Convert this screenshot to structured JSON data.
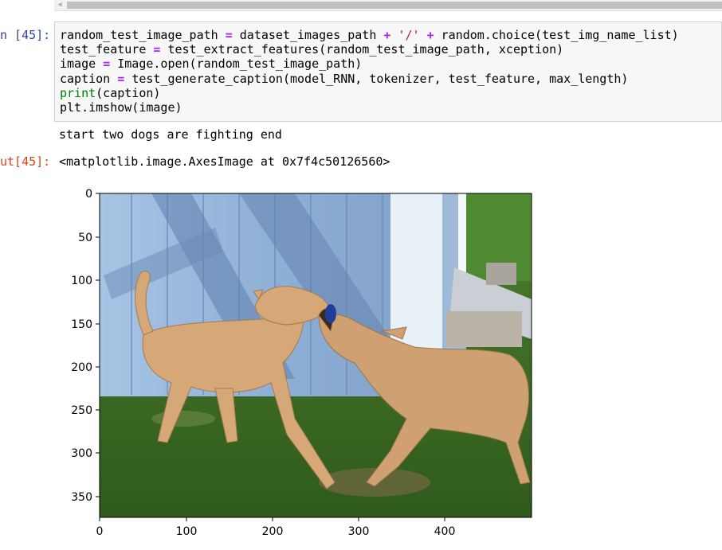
{
  "cell": {
    "in_prompt": "n [45]:",
    "out_prompt": "ut[45]:",
    "code": {
      "line1": {
        "v1": "random_test_image_path",
        "v2": "dataset_images_path",
        "str": "'/'",
        "v3": "random.choice(test_img_name_list)"
      },
      "line2": {
        "v1": "test_feature",
        "v2": "test_extract_features(random_test_image_path, xception)"
      },
      "line3": {
        "v1": "image",
        "v2": "Image.open(random_test_image_path)"
      },
      "line4": {
        "v1": "caption",
        "v2": "test_generate_caption(model_RNN, tokenizer, test_feature, max_length)"
      },
      "line5": {
        "fn": "print",
        "args": "(caption)"
      },
      "line6": {
        "text": "plt.imshow(image)"
      }
    },
    "stdout": "start two dogs are fighting end",
    "output_repr": "<matplotlib.image.AxesImage at 0x7f4c50126560>"
  },
  "chart_data": {
    "type": "image",
    "x_ticks": [
      0,
      100,
      200,
      300,
      400
    ],
    "y_ticks": [
      0,
      50,
      100,
      150,
      200,
      250,
      300,
      350
    ],
    "xlim": [
      0,
      500
    ],
    "ylim": [
      375,
      0
    ],
    "image_description_icon": "photo-two-dogs-icon"
  }
}
